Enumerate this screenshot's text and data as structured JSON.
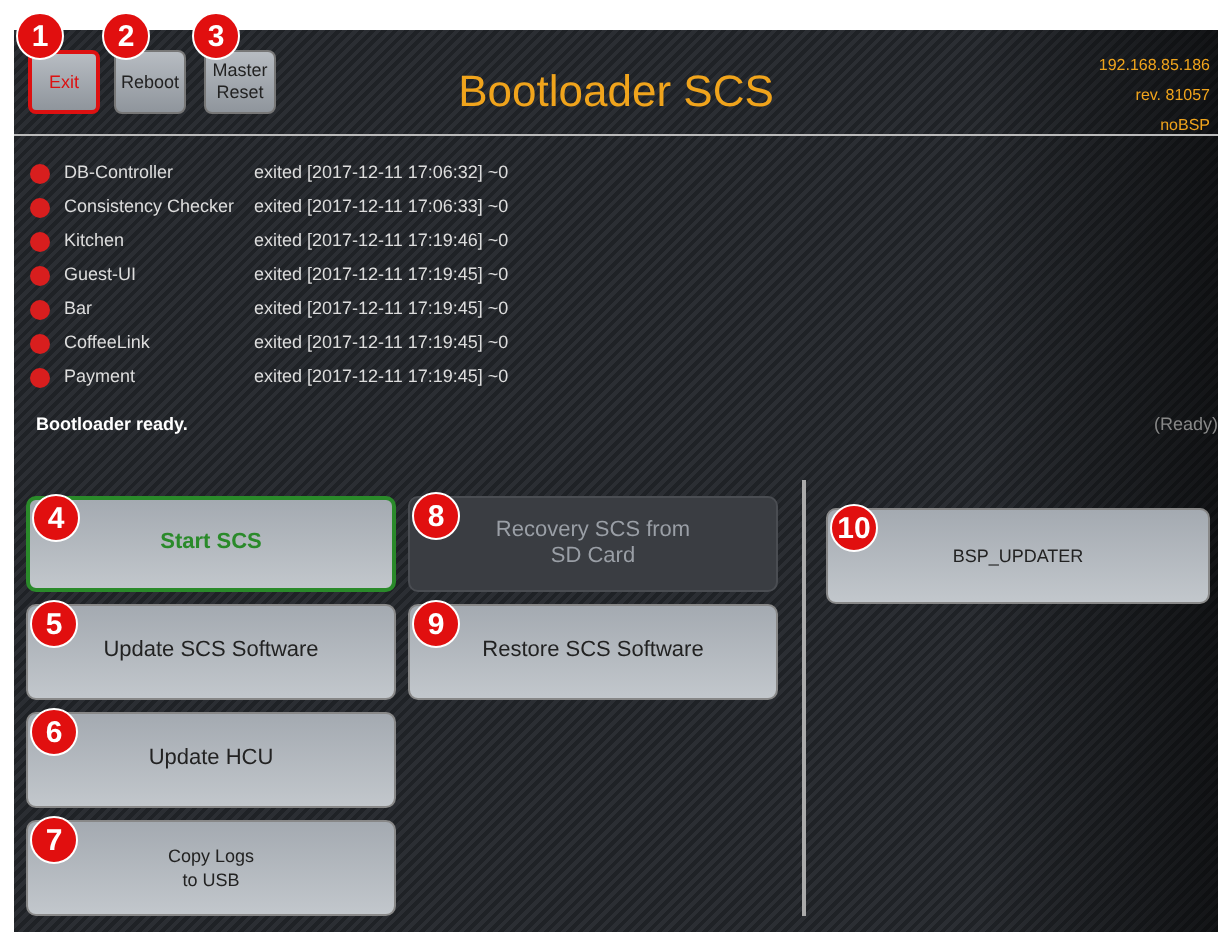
{
  "header": {
    "buttons": [
      {
        "label": "Exit",
        "kind": "danger",
        "callout": "1"
      },
      {
        "label": "Reboot",
        "kind": "normal",
        "callout": "2"
      },
      {
        "label": "Master\nReset",
        "kind": "normal",
        "callout": "3"
      }
    ],
    "title": "Bootloader SCS",
    "info": [
      "192.168.85.186",
      "rev. 81057",
      "noBSP"
    ]
  },
  "processes": [
    {
      "name": "DB-Controller",
      "status": "exited [2017-12-11 17:06:32] ~0",
      "color": "#d81e1e"
    },
    {
      "name": "Consistency Checker",
      "status": "exited [2017-12-11 17:06:33] ~0",
      "color": "#d81e1e"
    },
    {
      "name": "Kitchen",
      "status": "exited [2017-12-11 17:19:46] ~0",
      "color": "#d81e1e"
    },
    {
      "name": "Guest-UI",
      "status": "exited [2017-12-11 17:19:45] ~0",
      "color": "#d81e1e"
    },
    {
      "name": "Bar",
      "status": "exited [2017-12-11 17:19:45] ~0",
      "color": "#d81e1e"
    },
    {
      "name": "CoffeeLink",
      "status": "exited [2017-12-11 17:19:45] ~0",
      "color": "#d81e1e"
    },
    {
      "name": "Payment",
      "status": "exited [2017-12-11 17:19:45] ~0",
      "color": "#d81e1e"
    }
  ],
  "message": "Bootloader ready.",
  "state": "(Ready)",
  "actions": {
    "left": [
      {
        "label": "Start SCS",
        "kind": "success",
        "callout": "4",
        "disabled": false
      },
      {
        "label": "Update SCS Software",
        "kind": "normal",
        "callout": "5",
        "disabled": false
      },
      {
        "label": "Update HCU",
        "kind": "normal",
        "callout": "6",
        "disabled": false
      },
      {
        "label": "Copy Logs\nto USB",
        "kind": "small",
        "callout": "7",
        "disabled": false
      }
    ],
    "middle": [
      {
        "label": "Recovery SCS from\nSD Card",
        "kind": "normal",
        "callout": "8",
        "disabled": true
      },
      {
        "label": "Restore SCS Software",
        "kind": "normal",
        "callout": "9",
        "disabled": false
      }
    ],
    "right": [
      {
        "label": "BSP_UPDATER",
        "kind": "small",
        "callout": "10",
        "disabled": false
      }
    ]
  }
}
